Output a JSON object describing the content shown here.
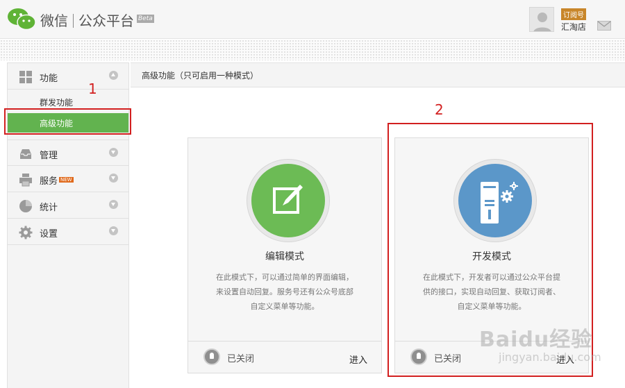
{
  "header": {
    "brand_primary": "微信",
    "brand_secondary": "公众平台",
    "beta": "Beta",
    "account_type": "订阅号",
    "account_name": "汇淘店"
  },
  "sidebar": {
    "items": [
      {
        "label": "功能",
        "icon": "grid-icon",
        "expanded": true
      },
      {
        "label": "管理",
        "icon": "inbox-icon"
      },
      {
        "label": "服务",
        "icon": "printer-icon",
        "badge": "NEW"
      },
      {
        "label": "统计",
        "icon": "pie-chart-icon"
      },
      {
        "label": "设置",
        "icon": "gear-icon"
      }
    ],
    "sub_items": [
      {
        "label": "群发功能"
      },
      {
        "label": "高级功能",
        "active": true
      }
    ]
  },
  "main": {
    "title": "高级功能（只可启用一种模式）"
  },
  "cards": [
    {
      "title": "编辑模式",
      "icon": "edit-icon",
      "desc_lines": [
        "在此模式下，可以通过简单的界面编辑，",
        "来设置自动回复。服务号还有公众号底部",
        "自定义菜单等功能。"
      ],
      "status": "已关闭",
      "action": "进入"
    },
    {
      "title": "开发模式",
      "icon": "server-gear-icon",
      "desc_lines": [
        "在此模式下，开发者可以通过公众平台提",
        "供的接口，实现自动回复、获取订阅者、",
        "自定义菜单等功能。"
      ],
      "status": "已关闭",
      "action": "进入"
    }
  ],
  "annotations": {
    "marker_1": "1",
    "marker_2": "2"
  },
  "watermark": {
    "line1": "Baidu经验",
    "line2": "jingyan.baidu.com"
  },
  "colors": {
    "accent_green": "#62b34f",
    "annotation_red": "#d21f1f",
    "edit_circle": "#6cbb55",
    "dev_circle": "#5b97c9"
  }
}
